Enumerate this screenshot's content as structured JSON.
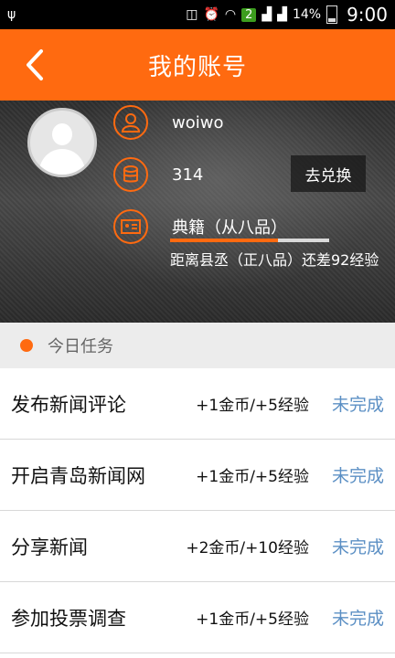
{
  "status_bar": {
    "battery": "14%",
    "time": "9:00",
    "notification_badge": "2"
  },
  "header": {
    "back_icon": "chevron-left-icon",
    "title": "我的账号"
  },
  "profile": {
    "username": "woiwo",
    "coins": "314",
    "exchange_label": "去兑换",
    "rank": "典籍（从八品）",
    "progress": 0.68,
    "next_rank_hint": "距离县丞（正八品）还差92经验"
  },
  "section": {
    "title": "今日任务"
  },
  "tasks": [
    {
      "name": "发布新闻评论",
      "reward": "+1金币/+5经验",
      "status": "未完成"
    },
    {
      "name": "开启青岛新闻网",
      "reward": "+1金币/+5经验",
      "status": "未完成"
    },
    {
      "name": "分享新闻",
      "reward": "+2金币/+10经验",
      "status": "未完成"
    },
    {
      "name": "参加投票调查",
      "reward": "+1金币/+5经验",
      "status": "未完成"
    }
  ],
  "colors": {
    "accent": "#ff6a10",
    "status_link": "#5b8fc4"
  }
}
